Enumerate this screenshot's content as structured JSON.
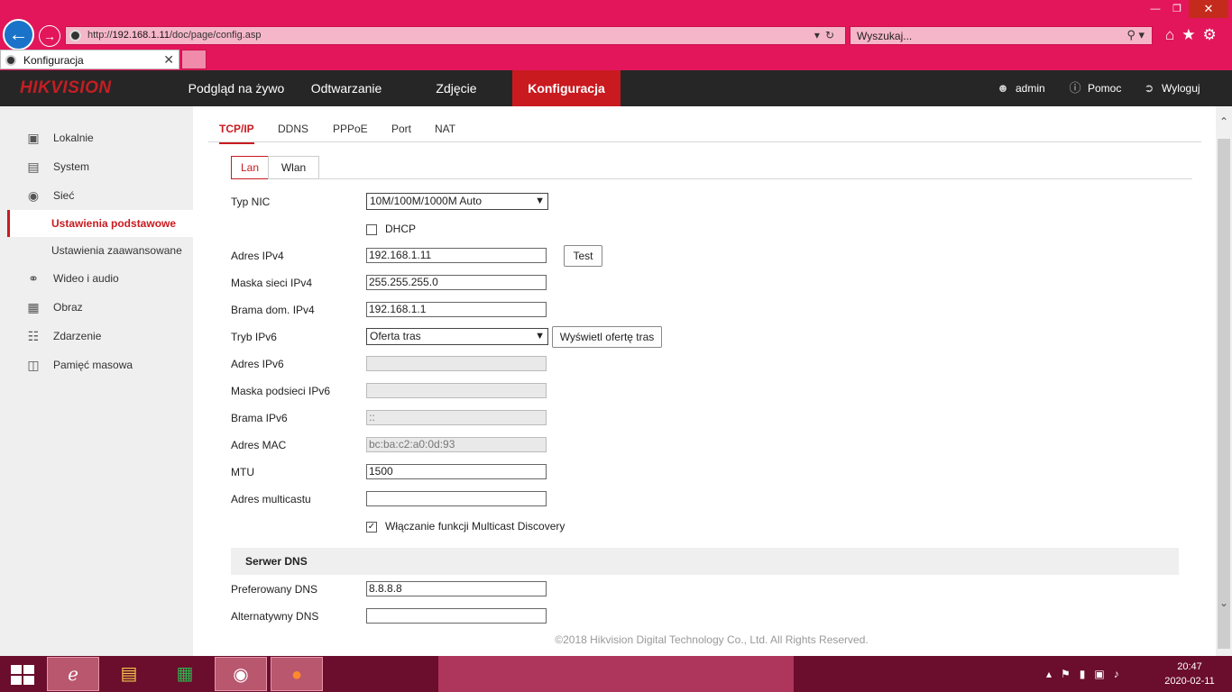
{
  "browser": {
    "url_prefix": "http://",
    "url_host": "192.168.1.11",
    "url_path": "/doc/page/config.asp",
    "search_placeholder": "Wyszukaj...",
    "tab_title": "Konfiguracja"
  },
  "app": {
    "logo_a": "HIK",
    "logo_b": "VISION",
    "nav": [
      "Podgląd na żywo",
      "Odtwarzanie",
      "Zdjęcie",
      "Konfiguracja"
    ],
    "user": "admin",
    "help": "Pomoc",
    "logout": "Wyloguj"
  },
  "sidebar": {
    "lokalnie": "Lokalnie",
    "system": "System",
    "siec": "Sieć",
    "ustawienia_podstawowe": "Ustawienia podstawowe",
    "ustawienia_zaawansowane": "Ustawienia zaawansowane",
    "wideo": "Wideo i audio",
    "obraz": "Obraz",
    "zdarzenie": "Zdarzenie",
    "pamiec": "Pamięć masowa"
  },
  "tabs": [
    "TCP/IP",
    "DDNS",
    "PPPoE",
    "Port",
    "NAT"
  ],
  "subtabs": [
    "Lan",
    "Wlan"
  ],
  "form": {
    "typ_nic_label": "Typ NIC",
    "typ_nic_value": "10M/100M/1000M Auto",
    "dhcp_label": "DHCP",
    "ipv4_label": "Adres IPv4",
    "ipv4_value": "192.168.1.11",
    "test_label": "Test",
    "mask_label": "Maska sieci IPv4",
    "mask_value": "255.255.255.0",
    "gw_label": "Brama dom. IPv4",
    "gw_value": "192.168.1.1",
    "ipv6_mode_label": "Tryb IPv6",
    "ipv6_mode_value": "Oferta tras",
    "route_btn": "Wyświetl ofertę tras",
    "ipv6_label": "Adres IPv6",
    "ipv6_value": "",
    "ipv6_mask_label": "Maska podsieci IPv6",
    "ipv6_mask_value": "",
    "ipv6_gw_label": "Brama IPv6",
    "ipv6_gw_value": "::",
    "mac_label": "Adres MAC",
    "mac_value": "bc:ba:c2:a0:0d:93",
    "mtu_label": "MTU",
    "mtu_value": "1500",
    "multicast_label": "Adres multicastu",
    "multicast_value": "",
    "multicast_discovery_label": "Włączanie funkcji Multicast Discovery",
    "dns_section": "Serwer DNS",
    "dns1_label": "Preferowany DNS",
    "dns1_value": "8.8.8.8",
    "dns2_label": "Alternatywny DNS",
    "dns2_value": ""
  },
  "footer": "©2018 Hikvision Digital Technology Co., Ltd. All Rights Reserved.",
  "taskbar": {
    "time": "20:47",
    "date": "2020-02-11"
  },
  "colors": {
    "accent": "#c91a20",
    "header": "#262626",
    "chrome": "#e3165b"
  }
}
